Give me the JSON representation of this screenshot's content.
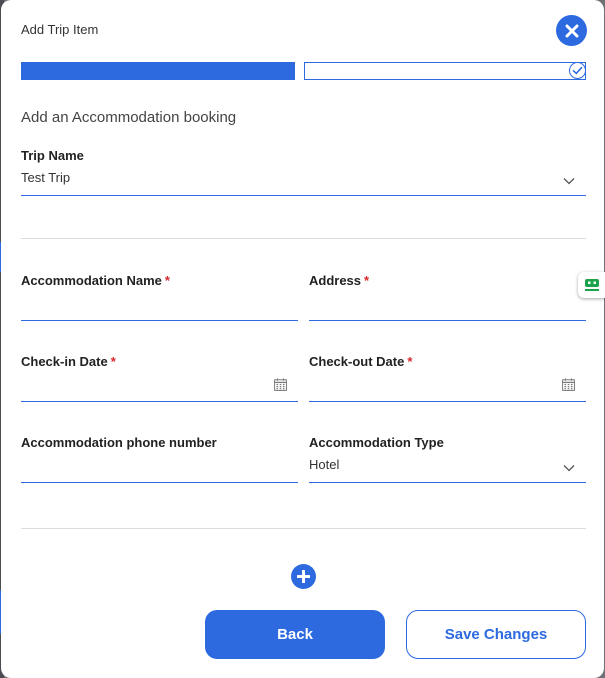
{
  "modal": {
    "title": "Add Trip Item",
    "subtitle": "Add an Accommodation booking"
  },
  "progress": {
    "step": 1,
    "total_steps": 2,
    "filled_fraction": 0.5
  },
  "form": {
    "trip_name": {
      "label": "Trip Name",
      "value": "Test Trip"
    },
    "accommodation_name": {
      "label": "Accommodation Name",
      "required_mark": "*",
      "value": ""
    },
    "address": {
      "label": "Address",
      "required_mark": "*",
      "value": ""
    },
    "check_in": {
      "label": "Check-in Date",
      "required_mark": "*",
      "value": ""
    },
    "check_out": {
      "label": "Check-out Date",
      "required_mark": "*",
      "value": ""
    },
    "phone": {
      "label": "Accommodation phone number",
      "value": ""
    },
    "type": {
      "label": "Accommodation Type",
      "value": "Hotel"
    }
  },
  "buttons": {
    "back": "Back",
    "save": "Save Changes"
  },
  "icons": {
    "close": "close-icon",
    "check": "check-icon",
    "chevron": "chevron-down-icon",
    "calendar": "calendar-icon",
    "add": "plus-icon",
    "side": "robot-icon"
  },
  "colors": {
    "accent": "#2d6ae0",
    "required": "#d9262c",
    "side_tab_icon": "#1aa34a"
  }
}
